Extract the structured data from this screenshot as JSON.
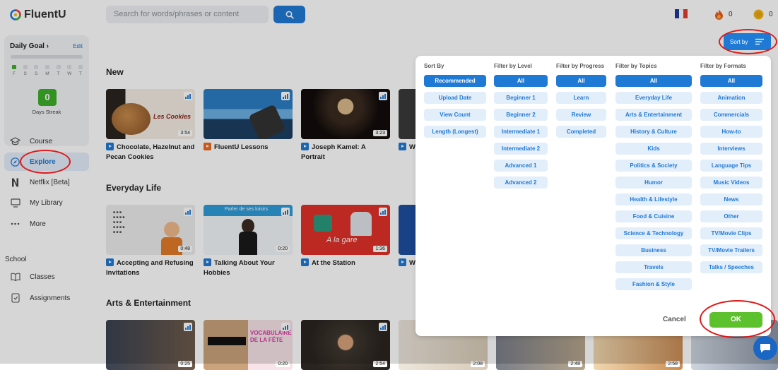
{
  "app": {
    "name": "FluentU"
  },
  "search": {
    "placeholder": "Search for words/phrases or content"
  },
  "header": {
    "streak_count": "0",
    "coins_count": "0"
  },
  "daily_goal": {
    "title": "Daily Goal ›",
    "edit_label": "Edit",
    "days": [
      "F",
      "S",
      "S",
      "M",
      "T",
      "W",
      "T"
    ],
    "streak_value": "0",
    "streak_label": "Days Streak"
  },
  "nav": [
    {
      "label": "Course",
      "icon": "graduation-cap-icon"
    },
    {
      "label": "Explore",
      "icon": "compass-icon"
    },
    {
      "label": "Netflix [Beta]",
      "icon": "netflix-icon"
    },
    {
      "label": "My Library",
      "icon": "monitor-icon"
    },
    {
      "label": "More",
      "icon": "ellipsis-icon"
    }
  ],
  "school": {
    "heading": "School",
    "items": [
      {
        "label": "Classes",
        "icon": "book-icon"
      },
      {
        "label": "Assignments",
        "icon": "assignment-icon"
      }
    ]
  },
  "sections": [
    {
      "title": "New",
      "cards": [
        {
          "title": "Chocolate, Hazelnut and Pecan Cookies",
          "duration": "3:54"
        },
        {
          "title": "FluentU Lessons",
          "duration": ""
        },
        {
          "title": "Joseph Kamel: A Portrait",
          "duration": "3:23"
        },
        {
          "title": "W",
          "duration": ""
        }
      ]
    },
    {
      "title": "Everyday Life",
      "cards": [
        {
          "title": "Accepting and Refusing Invitations",
          "duration": "0:48"
        },
        {
          "title": "Talking About Your Hobbies",
          "duration": "0:20"
        },
        {
          "title": "At the Station",
          "duration": "1:36"
        },
        {
          "title": "W You S",
          "duration": ""
        }
      ]
    },
    {
      "title": "Arts & Entertainment",
      "cards": [
        {
          "title": "",
          "duration": "0:25"
        },
        {
          "title": "",
          "duration": "0:20"
        },
        {
          "title": "",
          "duration": "2:54"
        },
        {
          "title": "",
          "duration": "2:08"
        },
        {
          "title": "",
          "duration": "2:48"
        },
        {
          "title": "",
          "duration": "2:58"
        }
      ]
    }
  ],
  "thumb_text": {
    "cookies": "Les Cookies",
    "hobbies_header": "Parler de ses loisirs",
    "station": "A la gare",
    "vocab": "VOCABULAIRE DE LA FÊTE"
  },
  "sort_button": {
    "label": "Sort by"
  },
  "filters": {
    "columns": [
      {
        "heading": "Sort By",
        "options": [
          "Recommended",
          "Upload Date",
          "View Count",
          "Length (Longest)"
        ],
        "selected": 0
      },
      {
        "heading": "Filter by Level",
        "options": [
          "All",
          "Beginner 1",
          "Beginner 2",
          "Intermediate 1",
          "Intermediate 2",
          "Advanced 1",
          "Advanced 2"
        ],
        "selected": 0
      },
      {
        "heading": "Filter by Progress",
        "options": [
          "All",
          "Learn",
          "Review",
          "Completed"
        ],
        "selected": 0
      },
      {
        "heading": "Filter by Topics",
        "options": [
          "All",
          "Everyday Life",
          "Arts & Entertainment",
          "History & Culture",
          "Kids",
          "Politics & Society",
          "Humor",
          "Health & Lifestyle",
          "Food & Cuisine",
          "Science & Technology",
          "Business",
          "Travels",
          "Fashion & Style"
        ],
        "selected": 0
      },
      {
        "heading": "Filter by Formats",
        "options": [
          "All",
          "Animation",
          "Commercials",
          "How-to",
          "Interviews",
          "Language Tips",
          "Music Videos",
          "News",
          "Other",
          "TV/Movie Clips",
          "TV/Movie Trailers",
          "Talks / Speeches"
        ],
        "selected": 0
      }
    ],
    "cancel_label": "Cancel",
    "ok_label": "OK"
  },
  "colors": {
    "accent": "#1f7ad6",
    "ok_green": "#5dc02d",
    "streak_green": "#3fae2a",
    "annotation_red": "#e01818"
  }
}
